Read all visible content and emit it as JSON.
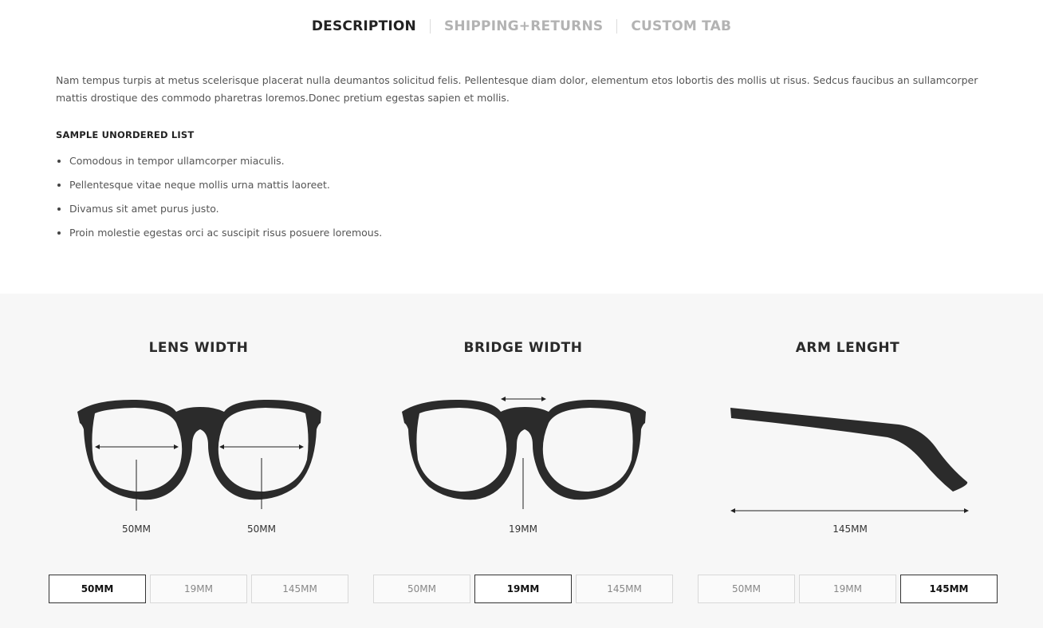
{
  "tabs": [
    {
      "label": "DESCRIPTION",
      "active": true
    },
    {
      "label": "SHIPPING+RETURNS",
      "active": false
    },
    {
      "label": "CUSTOM TAB",
      "active": false
    }
  ],
  "description": {
    "paragraph": "Nam tempus turpis at metus scelerisque placerat nulla deumantos solicitud felis. Pellentesque diam dolor, elementum etos lobortis des mollis ut risus. Sedcus faucibus an sullamcorper mattis drostique des commodo pharetras loremos.Donec pretium egestas sapien et mollis.",
    "list_title": "SAMPLE UNORDERED LIST",
    "list_items": [
      "Comodous in tempor ullamcorper miaculis.",
      "Pellentesque vitae neque mollis urna mattis laoreet.",
      "Divamus sit amet purus justo.",
      "Proin molestie egestas orci ac suscipit risus posuere loremous."
    ]
  },
  "size_guide": {
    "lens": {
      "title": "LENS WIDTH",
      "measure_left": "50MM",
      "measure_right": "50MM",
      "buttons": [
        "50MM",
        "19MM",
        "145MM"
      ],
      "selected": "50MM"
    },
    "bridge": {
      "title": "BRIDGE WIDTH",
      "measure": "19MM",
      "buttons": [
        "50MM",
        "19MM",
        "145MM"
      ],
      "selected": "19MM"
    },
    "arm": {
      "title": "ARM LENGHT",
      "measure": "145MM",
      "buttons": [
        "50MM",
        "19MM",
        "145MM"
      ],
      "selected": "145MM"
    }
  },
  "colors": {
    "frame": "#2b2b2b",
    "section_bg": "#f7f7f7",
    "tab_active": "#222222",
    "tab_inactive": "#b3b3b3"
  }
}
